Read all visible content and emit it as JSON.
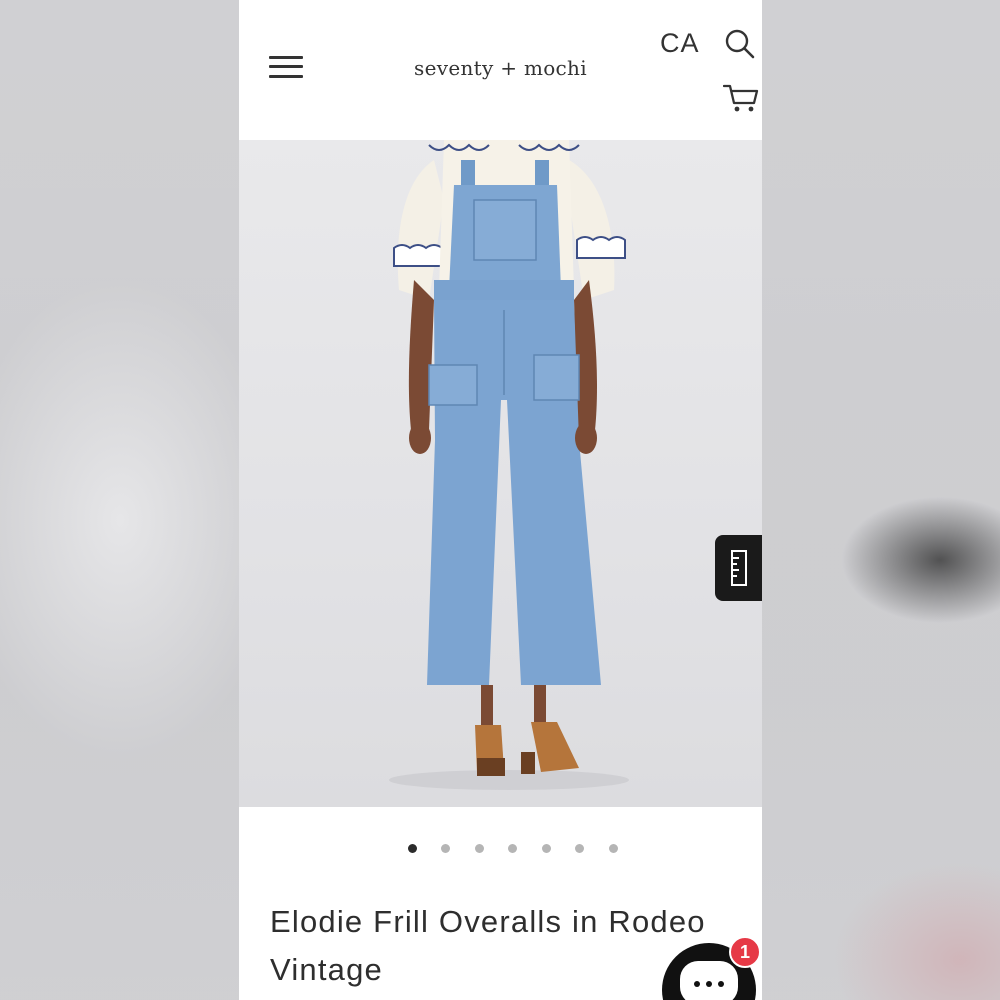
{
  "header": {
    "logo": "seventy + mochi",
    "region": "CA",
    "icons": [
      "menu-icon",
      "search-icon",
      "cart-icon"
    ]
  },
  "gallery": {
    "image_description": "model wearing light-wash denim overalls",
    "slide_count": 7,
    "active_index": 0
  },
  "product": {
    "title": "Elodie Frill Overalls in Rodeo Vintage"
  },
  "chat": {
    "unread_count": "1"
  },
  "colors": {
    "badge": "#e63946",
    "text": "#2e2e2e",
    "dot_active": "#2b2b2b",
    "dot_inactive": "#b5b5b5"
  }
}
